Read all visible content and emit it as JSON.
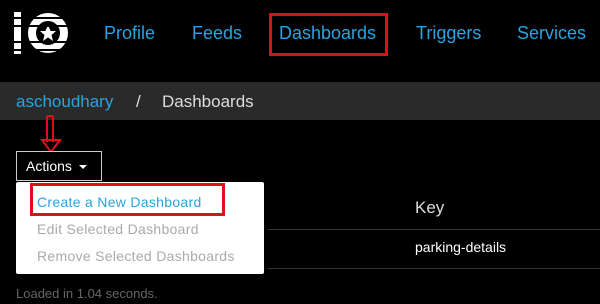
{
  "nav": {
    "items": [
      "Profile",
      "Feeds",
      "Dashboards",
      "Triggers",
      "Services"
    ]
  },
  "breadcrumb": {
    "user": "aschoudhary",
    "separator": "/",
    "current": "Dashboards"
  },
  "actions": {
    "label": "Actions",
    "menu": [
      "Create a New Dashboard",
      "Edit Selected Dashboard",
      "Remove Selected Dashboards"
    ]
  },
  "table": {
    "key_header": "Key",
    "rows": [
      {
        "key": "parking-details"
      }
    ]
  },
  "footer": {
    "loaded_text": "Loaded in 1.04 seconds."
  },
  "colors": {
    "accent": "#2aa3e0",
    "highlight": "#e0101b"
  }
}
